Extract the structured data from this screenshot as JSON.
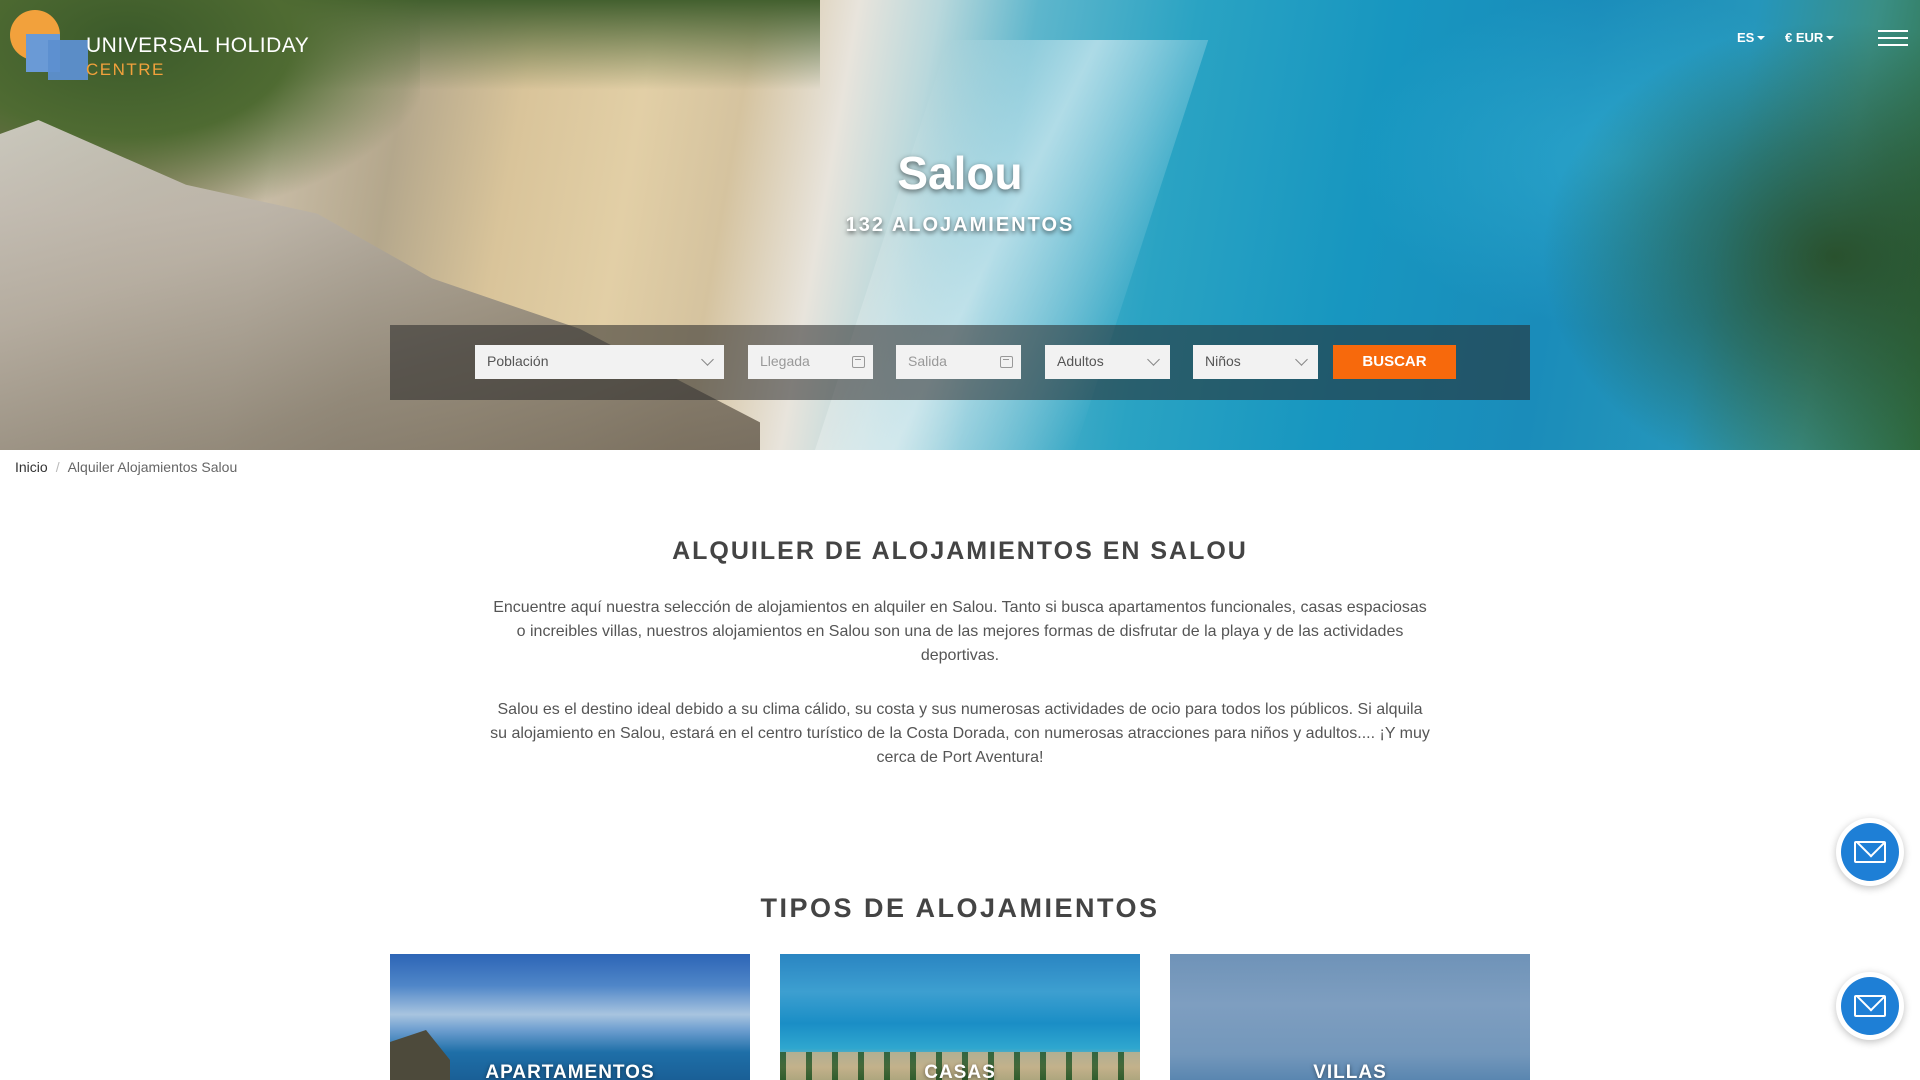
{
  "brand": {
    "name_line1": "UNIVERSAL HOLIDAY",
    "name_line2": "CENTRE"
  },
  "header": {
    "language": "ES",
    "currency": "€ EUR",
    "menu_icon": "hamburger-icon"
  },
  "hero": {
    "title": "Salou",
    "subtitle": "132 ALOJAMIENTOS"
  },
  "search": {
    "poblacion_placeholder": "Población",
    "llegada_placeholder": "Llegada",
    "salida_placeholder": "Salida",
    "adultos_placeholder": "Adultos",
    "ninos_placeholder": "Niños",
    "button_label": "BUSCAR",
    "button_color": "#f7690c"
  },
  "breadcrumb": {
    "home": "Inicio",
    "separator": "/",
    "current": "Alquiler Alojamientos Salou"
  },
  "intro": {
    "title": "ALQUILER DE ALOJAMIENTOS EN SALOU",
    "paragraph1": "Encuentre aquí nuestra selección de alojamientos en alquiler en Salou. Tanto si busca apartamentos funcionales, casas espaciosas o increibles villas, nuestros alojamientos en Salou son una de las mejores formas de disfrutar de la playa y de las actividades deportivas.",
    "paragraph2": "Salou es el destino ideal debido a su clima cálido, su costa y sus numerosas actividades de ocio para todos los públicos. Si alquila su alojamiento en Salou, estará en el centro turístico de la Costa Dorada, con numerosas atracciones para niños y adultos.... ¡Y muy cerca de Port Aventura!"
  },
  "types": {
    "title": "TIPOS DE ALOJAMIENTOS",
    "cards": [
      {
        "label": "APARTAMENTOS"
      },
      {
        "label": "CASAS"
      },
      {
        "label": "VILLAS"
      }
    ]
  },
  "floating": {
    "icon": "mail-icon",
    "color": "#1e7fd6"
  }
}
